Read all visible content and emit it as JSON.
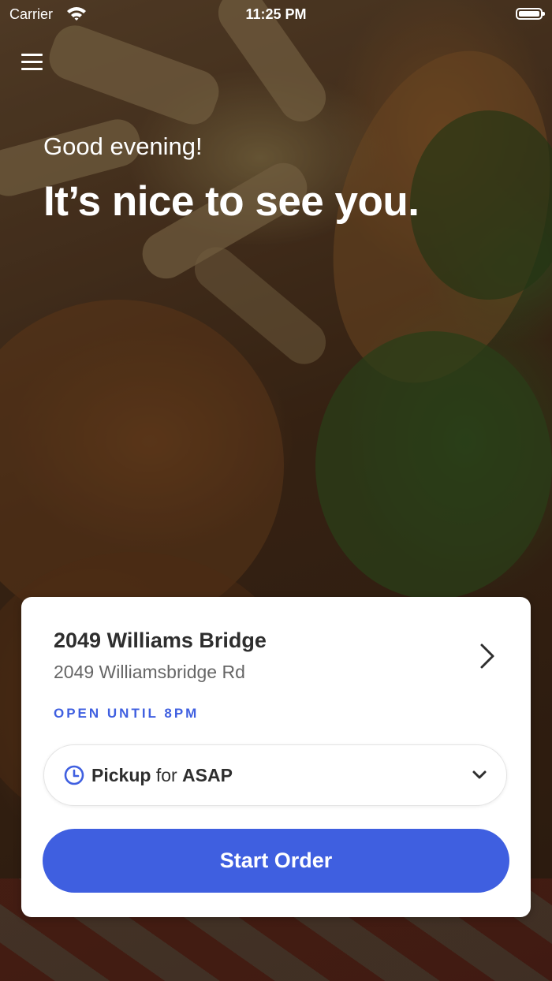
{
  "status_bar": {
    "carrier": "Carrier",
    "time": "11:25 PM"
  },
  "header": {
    "menu_icon": "hamburger-menu-icon",
    "greeting": "Good evening!",
    "headline": "It’s nice to see you."
  },
  "location_card": {
    "name": "2049 Williams Bridge",
    "address": "2049 Williamsbridge Rd",
    "hours": "OPEN UNTIL 8PM",
    "pickup": {
      "mode": "Pickup",
      "connector": "for",
      "time": "ASAP"
    },
    "start_button": "Start Order"
  },
  "colors": {
    "accent": "#3f5fe0",
    "card_background": "#ffffff",
    "text_primary": "#2e2e2e",
    "text_secondary": "#666666"
  }
}
